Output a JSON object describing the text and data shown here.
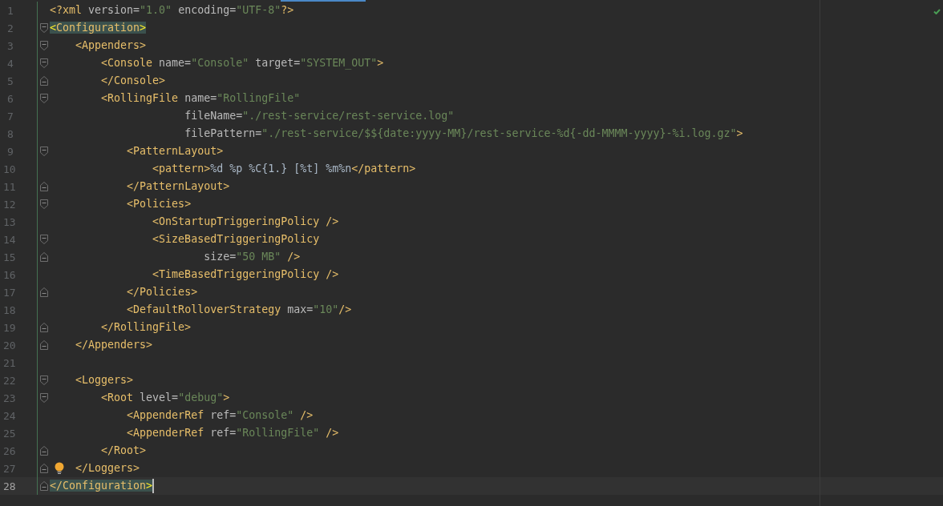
{
  "editor": {
    "inspection_ok": true,
    "lines": [
      {
        "number": "1",
        "fold_start": false,
        "fold_end": false,
        "current": false,
        "intention": false,
        "tokens": [
          {
            "kind": "tag",
            "text": "<?xml"
          },
          {
            "kind": "attr",
            "text": " version="
          },
          {
            "kind": "value",
            "text": "\"1.0\""
          },
          {
            "kind": "attr",
            "text": " encoding="
          },
          {
            "kind": "value",
            "text": "\"UTF-8\""
          },
          {
            "kind": "tag",
            "text": "?>"
          }
        ]
      },
      {
        "number": "2",
        "fold_start": true,
        "fold_end": false,
        "current": false,
        "intention": false,
        "tokens": [
          {
            "kind": "brace",
            "text": "<",
            "matched": true
          },
          {
            "kind": "tag",
            "text": "Configuration",
            "matched": true
          },
          {
            "kind": "brace",
            "text": ">",
            "matched": true
          }
        ]
      },
      {
        "number": "3",
        "fold_start": true,
        "fold_end": false,
        "current": false,
        "intention": false,
        "tokens": [
          {
            "kind": "tag",
            "text": "    <Appenders>"
          }
        ]
      },
      {
        "number": "4",
        "fold_start": true,
        "fold_end": false,
        "current": false,
        "intention": false,
        "tokens": [
          {
            "kind": "tag",
            "text": "        <Console"
          },
          {
            "kind": "attr",
            "text": " name="
          },
          {
            "kind": "value",
            "text": "\"Console\""
          },
          {
            "kind": "attr",
            "text": " target="
          },
          {
            "kind": "value",
            "text": "\"SYSTEM_OUT\""
          },
          {
            "kind": "tag",
            "text": ">"
          }
        ]
      },
      {
        "number": "5",
        "fold_start": false,
        "fold_end": true,
        "current": false,
        "intention": false,
        "tokens": [
          {
            "kind": "tag",
            "text": "        </Console>"
          }
        ]
      },
      {
        "number": "6",
        "fold_start": true,
        "fold_end": false,
        "current": false,
        "intention": false,
        "tokens": [
          {
            "kind": "tag",
            "text": "        <RollingFile"
          },
          {
            "kind": "attr",
            "text": " name="
          },
          {
            "kind": "value",
            "text": "\"RollingFile\""
          }
        ]
      },
      {
        "number": "7",
        "fold_start": false,
        "fold_end": false,
        "current": false,
        "intention": false,
        "tokens": [
          {
            "kind": "attr",
            "text": "                     fileName="
          },
          {
            "kind": "value",
            "text": "\"./rest-service/rest-service.log\""
          }
        ]
      },
      {
        "number": "8",
        "fold_start": false,
        "fold_end": false,
        "current": false,
        "intention": false,
        "tokens": [
          {
            "kind": "attr",
            "text": "                     filePattern="
          },
          {
            "kind": "value",
            "text": "\"./rest-service/$${date:yyyy-MM}/rest-service-%d{-dd-MMMM-yyyy}-%i.log.gz\""
          },
          {
            "kind": "tag",
            "text": ">"
          }
        ]
      },
      {
        "number": "9",
        "fold_start": true,
        "fold_end": false,
        "current": false,
        "intention": false,
        "tokens": [
          {
            "kind": "tag",
            "text": "            <PatternLayout>"
          }
        ]
      },
      {
        "number": "10",
        "fold_start": false,
        "fold_end": false,
        "current": false,
        "intention": false,
        "tokens": [
          {
            "kind": "tag",
            "text": "                <pattern>"
          },
          {
            "kind": "text",
            "text": "%d %p %C{1.} [%t] %m%n"
          },
          {
            "kind": "tag",
            "text": "</pattern>"
          }
        ]
      },
      {
        "number": "11",
        "fold_start": false,
        "fold_end": true,
        "current": false,
        "intention": false,
        "tokens": [
          {
            "kind": "tag",
            "text": "            </PatternLayout>"
          }
        ]
      },
      {
        "number": "12",
        "fold_start": true,
        "fold_end": false,
        "current": false,
        "intention": false,
        "tokens": [
          {
            "kind": "tag",
            "text": "            <Policies>"
          }
        ]
      },
      {
        "number": "13",
        "fold_start": false,
        "fold_end": false,
        "current": false,
        "intention": false,
        "tokens": [
          {
            "kind": "tag",
            "text": "                <OnStartupTriggeringPolicy />"
          }
        ]
      },
      {
        "number": "14",
        "fold_start": true,
        "fold_end": false,
        "current": false,
        "intention": false,
        "tokens": [
          {
            "kind": "tag",
            "text": "                <SizeBasedTriggeringPolicy"
          }
        ]
      },
      {
        "number": "15",
        "fold_start": false,
        "fold_end": true,
        "current": false,
        "intention": false,
        "tokens": [
          {
            "kind": "attr",
            "text": "                        size="
          },
          {
            "kind": "value",
            "text": "\"50 MB\""
          },
          {
            "kind": "tag",
            "text": " />"
          }
        ]
      },
      {
        "number": "16",
        "fold_start": false,
        "fold_end": false,
        "current": false,
        "intention": false,
        "tokens": [
          {
            "kind": "tag",
            "text": "                <TimeBasedTriggeringPolicy />"
          }
        ]
      },
      {
        "number": "17",
        "fold_start": false,
        "fold_end": true,
        "current": false,
        "intention": false,
        "tokens": [
          {
            "kind": "tag",
            "text": "            </Policies>"
          }
        ]
      },
      {
        "number": "18",
        "fold_start": false,
        "fold_end": false,
        "current": false,
        "intention": false,
        "tokens": [
          {
            "kind": "tag",
            "text": "            <DefaultRolloverStrategy"
          },
          {
            "kind": "attr",
            "text": " max="
          },
          {
            "kind": "value",
            "text": "\"10\""
          },
          {
            "kind": "tag",
            "text": "/>"
          }
        ]
      },
      {
        "number": "19",
        "fold_start": false,
        "fold_end": true,
        "current": false,
        "intention": false,
        "tokens": [
          {
            "kind": "tag",
            "text": "        </RollingFile>"
          }
        ]
      },
      {
        "number": "20",
        "fold_start": false,
        "fold_end": true,
        "current": false,
        "intention": false,
        "tokens": [
          {
            "kind": "tag",
            "text": "    </Appenders>"
          }
        ]
      },
      {
        "number": "21",
        "fold_start": false,
        "fold_end": false,
        "current": false,
        "intention": false
      },
      {
        "number": "22",
        "fold_start": true,
        "fold_end": false,
        "current": false,
        "intention": false,
        "tokens": [
          {
            "kind": "tag",
            "text": "    <Loggers>"
          }
        ]
      },
      {
        "number": "23",
        "fold_start": true,
        "fold_end": false,
        "current": false,
        "intention": false,
        "tokens": [
          {
            "kind": "tag",
            "text": "        <Root"
          },
          {
            "kind": "attr",
            "text": " level="
          },
          {
            "kind": "value",
            "text": "\"debug\""
          },
          {
            "kind": "tag",
            "text": ">"
          }
        ]
      },
      {
        "number": "24",
        "fold_start": false,
        "fold_end": false,
        "current": false,
        "intention": false,
        "tokens": [
          {
            "kind": "tag",
            "text": "            <AppenderRef"
          },
          {
            "kind": "attr",
            "text": " ref="
          },
          {
            "kind": "value",
            "text": "\"Console\""
          },
          {
            "kind": "tag",
            "text": " />"
          }
        ]
      },
      {
        "number": "25",
        "fold_start": false,
        "fold_end": false,
        "current": false,
        "intention": false,
        "tokens": [
          {
            "kind": "tag",
            "text": "            <AppenderRef"
          },
          {
            "kind": "attr",
            "text": " ref="
          },
          {
            "kind": "value",
            "text": "\"RollingFile\""
          },
          {
            "kind": "tag",
            "text": " />"
          }
        ]
      },
      {
        "number": "26",
        "fold_start": false,
        "fold_end": true,
        "current": false,
        "intention": false,
        "tokens": [
          {
            "kind": "tag",
            "text": "        </Root>"
          }
        ]
      },
      {
        "number": "27",
        "fold_start": false,
        "fold_end": true,
        "current": false,
        "intention": true,
        "tokens": [
          {
            "kind": "tag",
            "text": "    </Loggers>"
          }
        ]
      },
      {
        "number": "28",
        "fold_start": false,
        "fold_end": true,
        "current": true,
        "intention": false,
        "tokens": [
          {
            "kind": "tag",
            "text": "</",
            "matched": true
          },
          {
            "kind": "tag",
            "text": "Configuration",
            "matched": true
          },
          {
            "kind": "brace",
            "text": ">",
            "matched": true
          }
        ]
      }
    ]
  }
}
